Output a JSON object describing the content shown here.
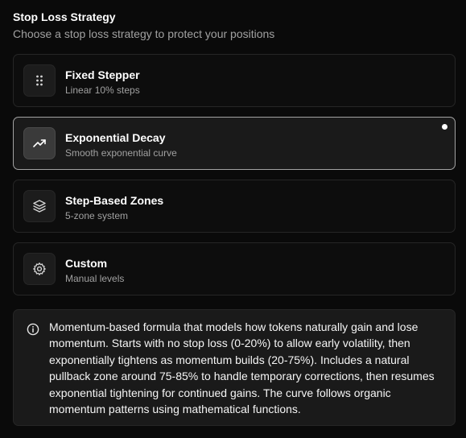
{
  "header": {
    "title": "Stop Loss Strategy",
    "subtitle": "Choose a stop loss strategy to protect your positions"
  },
  "options": [
    {
      "label": "Fixed Stepper",
      "description": "Linear 10% steps",
      "icon": "grip-dots-icon",
      "selected": false
    },
    {
      "label": "Exponential Decay",
      "description": "Smooth exponential curve",
      "icon": "trending-up-icon",
      "selected": true
    },
    {
      "label": "Step-Based Zones",
      "description": "5-zone system",
      "icon": "layers-icon",
      "selected": false
    },
    {
      "label": "Custom",
      "description": "Manual levels",
      "icon": "gear-icon",
      "selected": false
    }
  ],
  "info": {
    "icon": "info-icon",
    "text": "Momentum-based formula that models how tokens naturally gain and lose momentum. Starts with no stop loss (0-20%) to allow early volatility, then exponentially tightens as momentum builds (20-75%). Includes a natural pullback zone around 75-85% to handle temporary corrections, then resumes exponential tightening for continued gains. The curve follows organic momentum patterns using mathematical functions."
  },
  "colors": {
    "background": "#0a0a0a",
    "card": "#0d0d0d",
    "card_selected": "#1a1a1a",
    "border": "#262626",
    "border_selected": "#a3a3a3",
    "muted_text": "#a1a1a1"
  }
}
